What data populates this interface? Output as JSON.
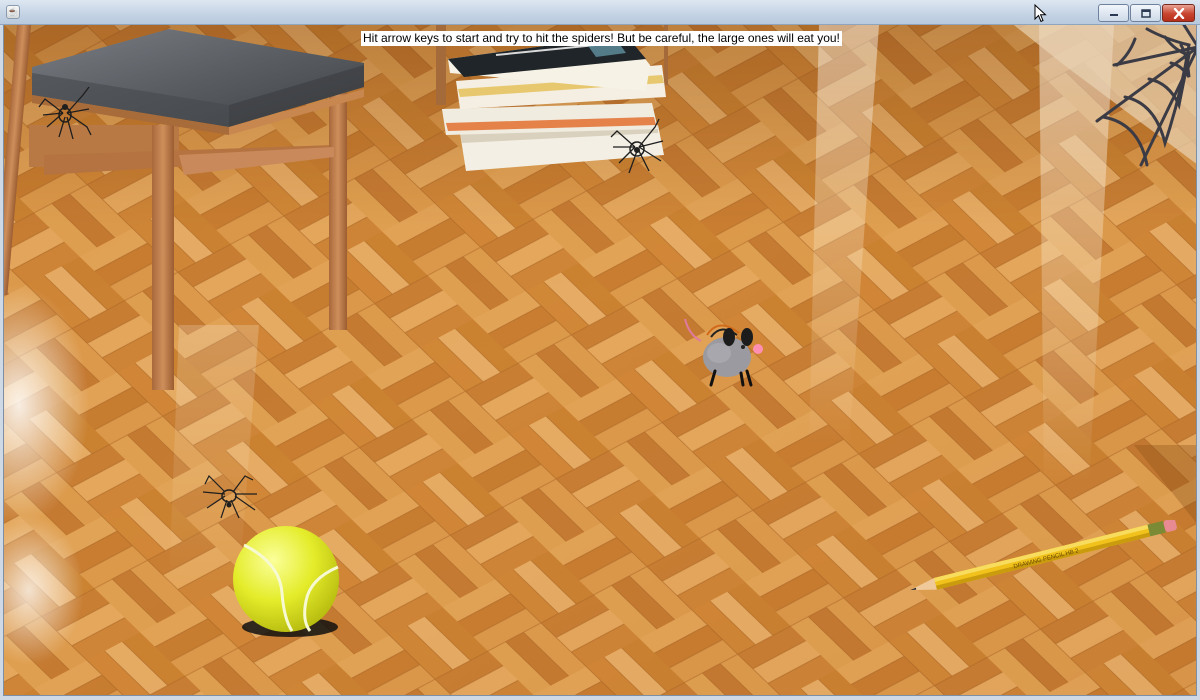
{
  "window": {
    "app_icon": "java-coffee-icon",
    "controls": {
      "minimize": "minimize-icon",
      "maximize": "maximize-icon",
      "close": "close-icon"
    },
    "accent_close": "#c8452f",
    "titlebar_color": "#c4d3e4"
  },
  "game": {
    "hint_text": "Hit arrow keys to start and try to hit the spiders! But be careful, the large ones will eat you!",
    "floor_color": "#d48a36",
    "objects": [
      "chair",
      "stack-of-books",
      "spider-web",
      "mouse-player",
      "tennis-ball",
      "pencil",
      "spider",
      "spider",
      "spider"
    ],
    "pencil_text": "DRAWING PENCIL HB 2"
  }
}
